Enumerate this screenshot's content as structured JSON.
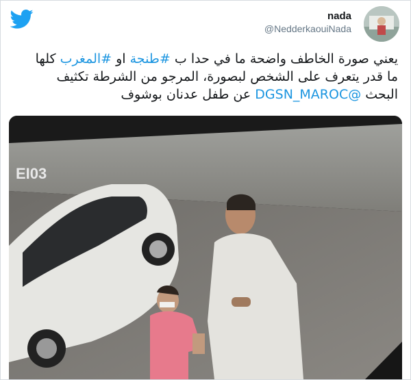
{
  "brand": {
    "icon": "twitter-bird-icon",
    "color": "#1da1f2"
  },
  "author": {
    "name": "nada",
    "handle": "@NedderkaouiNada",
    "avatar_icon": "avatar-icon"
  },
  "tweet": {
    "line1_a": "يعني صورة الخاطف واضحة ما في حدا ب ",
    "hashtag1": "#طنجة",
    "line1_b": " او ",
    "hashtag2": "#المغرب",
    "line1_c": " كلها",
    "line2": "ما قدر يتعرف على الشخص لبصورة، المرجو من الشرطة تكثيف",
    "line3_a": "البحث ",
    "mention": "@DGSN_MAROC",
    "line3_b": " عن طفل عدنان بوشوف"
  },
  "media": {
    "camera_label": "EI03",
    "description_icon": "cctv-photo"
  }
}
